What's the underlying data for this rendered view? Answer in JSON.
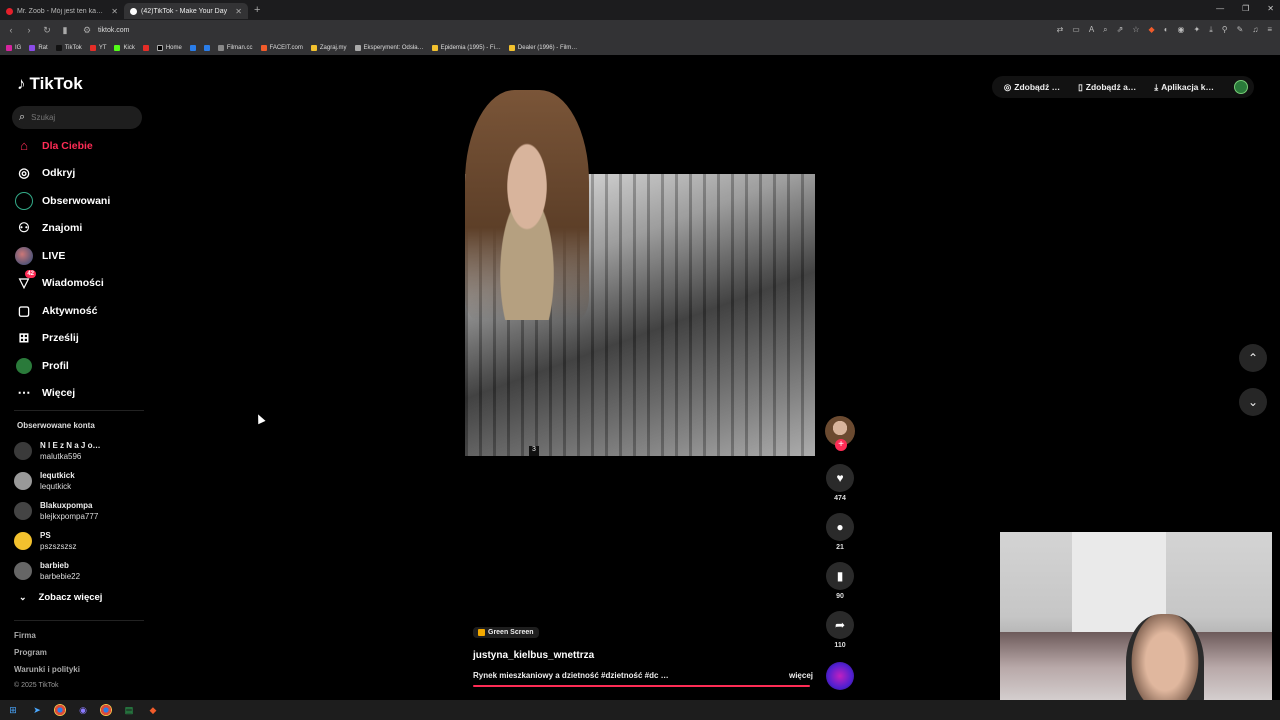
{
  "browser": {
    "tabs": [
      {
        "label": "Mr. Zoob - Mój jest ten kawałek podł…",
        "active": false
      },
      {
        "label": "(42)TikTok - Make Your Day",
        "active": true
      }
    ],
    "url": "tiktok.com",
    "bookmarks": [
      "IG",
      "Rat",
      "TikTok",
      "YT",
      "Kick",
      "Home",
      "Filman.cc",
      "FACEIT.com",
      "Zagraj.my",
      "Eksperyment: Odsła…",
      "Epidemia (1995) - Fi…",
      "Dealer (1996) - Film…"
    ]
  },
  "tiktok": {
    "logo": "TikTok",
    "search_placeholder": "Szukaj",
    "nav": [
      {
        "label": "Dla Ciebie",
        "icon": "home-icon",
        "active": true
      },
      {
        "label": "Odkryj",
        "icon": "compass-icon"
      },
      {
        "label": "Obserwowani",
        "icon": "following-avatar-icon"
      },
      {
        "label": "Znajomi",
        "icon": "friends-icon"
      },
      {
        "label": "LIVE",
        "icon": "live-icon"
      },
      {
        "label": "Wiadomości",
        "icon": "messages-icon",
        "badge": "42"
      },
      {
        "label": "Aktywność",
        "icon": "activity-icon"
      },
      {
        "label": "Prześlij",
        "icon": "upload-icon"
      },
      {
        "label": "Profil",
        "icon": "profile-avatar-icon"
      },
      {
        "label": "Więcej",
        "icon": "more-icon"
      }
    ],
    "followed_title": "Obserwowane konta",
    "followed": [
      {
        "name": "N I E z N a J o…",
        "handle": "malutka596"
      },
      {
        "name": "lequtkick",
        "handle": "lequtkick"
      },
      {
        "name": "Blakuxpompa",
        "handle": "blejkxpompa777"
      },
      {
        "name": "PS",
        "handle": "pszszszsz"
      },
      {
        "name": "barbieb",
        "handle": "barbebie22"
      }
    ],
    "see_more": "Zobacz więcej",
    "footer": [
      "Firma",
      "Program",
      "Warunki i polityki"
    ],
    "copyright": "© 2025 TikTok",
    "top_actions": [
      "Zdobądź …",
      "Zdobądź a…",
      "Aplikacja k…"
    ],
    "video": {
      "effect_chip": "Green Screen",
      "author": "justyna_kielbus_wnettrza",
      "description": "Rynek mieszkaniowy a dzietność #dzietność #dc …",
      "more_label": "więcej",
      "frame_number": "3",
      "likes": "474",
      "comments": "21",
      "saves": "90",
      "shares": "110",
      "progress": 0.99
    }
  }
}
